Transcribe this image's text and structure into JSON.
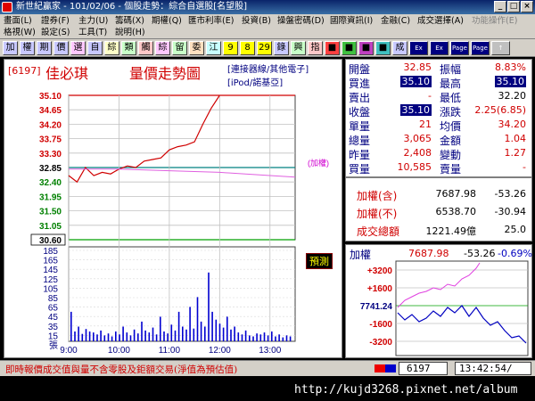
{
  "window": {
    "title": "新世紀贏家 - 101/02/06 - 個股走勢：綜合自選股[名望股]",
    "min": "_",
    "max": "□",
    "close": "×"
  },
  "menu": {
    "row1": [
      "畫面(L)",
      "證券(F)",
      "主力(U)",
      "籌碼(X)",
      "期權(Q)",
      "匯市利率(E)",
      "投資(B)",
      "操盤密碼(D)",
      "國際資訊(I)",
      "金融(C)",
      "成交選擇(A)",
      "功能操作(E)"
    ],
    "row2": [
      "格視(W)",
      "設定(S)",
      "工具(T)",
      "說明(H)"
    ]
  },
  "toolbar": {
    "buttons": [
      "加",
      "權",
      "期",
      "價",
      "選",
      "自",
      "綜",
      "類",
      "觸",
      "綜",
      "留",
      "委",
      "江",
      "9",
      "8",
      "29",
      "錄",
      "興",
      "指",
      "■",
      "■",
      "■",
      "■",
      "成",
      "Ex",
      "Ex",
      "Page",
      "Page",
      "↑"
    ]
  },
  "chart": {
    "code": "[6197]",
    "name": "佳必琪",
    "title": "量價走勢圖",
    "link1": "[連接器線/其他電子]",
    "link2": "[iPod/諾基亞]",
    "price_ticks": [
      "35.10",
      "34.65",
      "34.20",
      "33.75",
      "33.30",
      "32.85",
      "32.40",
      "31.95",
      "31.50",
      "31.05",
      "30.60"
    ],
    "vol_ticks": [
      "185",
      "165",
      "145",
      "125",
      "105",
      "85",
      "65",
      "45",
      "35",
      "15",
      "張"
    ],
    "time_ticks": [
      "9:00",
      "10:00",
      "11:00",
      "12:00",
      "13:00"
    ],
    "ref_label": "(加權)",
    "badge": "預測"
  },
  "chart_data": {
    "type": "line",
    "title": "量價走勢圖",
    "xlabel": "",
    "ylabel": "",
    "ylim": [
      30.6,
      35.1
    ],
    "series": [
      {
        "name": "",
        "x": [
          "9:00",
          "9:10",
          "9:20",
          "9:30",
          "9:40",
          "9:50",
          "10:00",
          "10:10",
          "10:20",
          "10:30",
          "10:40",
          "10:50",
          "11:00",
          "11:10",
          "11:20",
          "11:30",
          "11:40",
          "11:50",
          "12:00"
        ],
        "values": [
          32.6,
          32.4,
          32.85,
          32.6,
          32.7,
          32.65,
          32.8,
          32.9,
          32.85,
          33.05,
          33.1,
          33.15,
          33.4,
          33.5,
          33.55,
          33.65,
          34.2,
          34.7,
          35.1
        ]
      },
      {
        "name": "加權",
        "x": [
          "9:00",
          "10:00",
          "11:00",
          "12:00",
          "13:00",
          "13:30"
        ],
        "values": [
          32.8,
          32.8,
          32.75,
          32.7,
          32.6,
          32.55
        ]
      }
    ]
  },
  "quote": {
    "rows": [
      {
        "l1": "開盤",
        "v1": "32.85",
        "l2": "振幅",
        "v2": "8.83%"
      },
      {
        "l1": "買進",
        "v1": "35.10",
        "l2": "最高",
        "v2": "35.10"
      },
      {
        "l1": "賣出",
        "v1": "-",
        "l2": "最低",
        "v2": "32.20"
      },
      {
        "l1": "收盤",
        "v1": "35.10",
        "l2": "漲跌",
        "v2": "2.25(6.85)"
      },
      {
        "l1": "單量",
        "v1": "21",
        "l2": "均價",
        "v2": "34.20"
      },
      {
        "l1": "總量",
        "v1": "3,065",
        "l2": "金額",
        "v2": "1.04"
      },
      {
        "l1": "昨量",
        "v1": "2,408",
        "l2": "變動",
        "v2": "1.27"
      },
      {
        "l1": "買量",
        "v1": "10,585",
        "l2": "賣量",
        "v2": "-"
      }
    ],
    "index_rows": [
      {
        "label": "加權(含)",
        "value": "7687.98",
        "change": "-53.26"
      },
      {
        "label": "加權(不)",
        "value": "6538.70",
        "change": "-30.94"
      },
      {
        "label": "成交總額",
        "value": "1221.49億",
        "change": "25.0"
      }
    ]
  },
  "mini": {
    "label": "加權",
    "value": "7687.98",
    "change": "-53.26",
    "pct": "-0.69%",
    "ticks": [
      "+3200",
      "+1600",
      "7741.24",
      "-1600",
      "-3200"
    ]
  },
  "bottom": {
    "note": "即時報價成交值與量不含零股及鉅額交易(淨值為預估值)",
    "code_box": "6197",
    "time": "13:42:54/"
  },
  "status": {
    "watermark": "http://kujd3268.pixnet.net/album"
  }
}
